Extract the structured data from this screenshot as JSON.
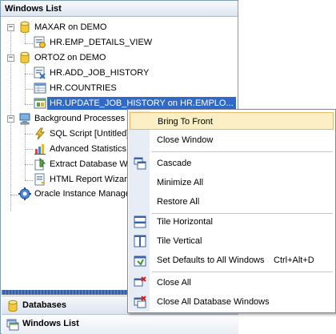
{
  "panel": {
    "title": "Windows List"
  },
  "tree": {
    "servers": [
      {
        "name": "MAXAR on DEMO",
        "children": [
          "HR.EMP_DETAILS_VIEW"
        ]
      },
      {
        "name": "ORTOZ on DEMO",
        "children": [
          "HR.ADD_JOB_HISTORY",
          "HR.COUNTRIES",
          "HR.UPDATE_JOB_HISTORY on HR.EMPLO..."
        ],
        "selected_index": 2
      }
    ],
    "background": {
      "name": "Background Processes",
      "children": [
        "SQL Script [Untitled]",
        "Advanced Statistics",
        "Extract Database W",
        "HTML Report Wizard"
      ]
    },
    "oracle": "Oracle Instance Manage"
  },
  "tabs": {
    "databases": "Databases",
    "windows_list": "Windows List"
  },
  "menu": {
    "items": [
      {
        "label": "Bring To Front",
        "icon": "none",
        "highlighted": true
      },
      {
        "label": "Close Window",
        "icon": "none"
      },
      {
        "label": "Cascade",
        "icon": "cascade-icon"
      },
      {
        "label": "Minimize All",
        "icon": "none"
      },
      {
        "label": "Restore All",
        "icon": "none"
      },
      {
        "label": "Tile Horizontal",
        "icon": "tile-horizontal-icon"
      },
      {
        "label": "Tile Vertical",
        "icon": "tile-vertical-icon"
      },
      {
        "label": "Set Defaults to All Windows",
        "shortcut": "Ctrl+Alt+D",
        "icon": "set-defaults-icon"
      },
      {
        "label": "Close All",
        "icon": "close-all-icon"
      },
      {
        "label": "Close All Database Windows",
        "icon": "close-all-db-icon"
      }
    ]
  },
  "colors": {
    "selection": "#3169c6",
    "menu_highlight": "#fcefc5",
    "menu_strip": "#e7ecf5"
  }
}
